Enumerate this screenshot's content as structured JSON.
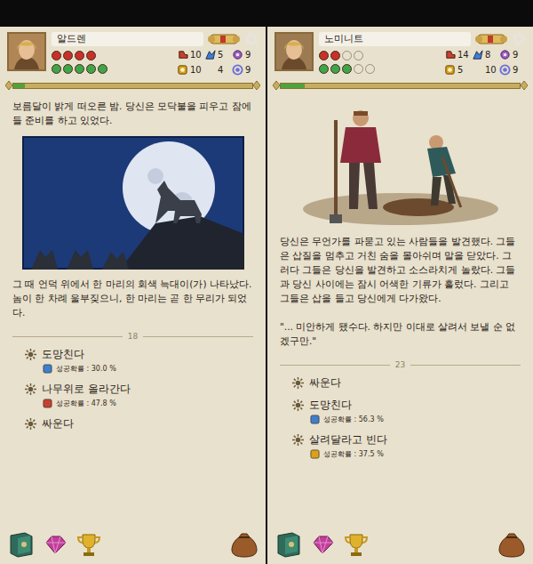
{
  "panels": [
    {
      "character": {
        "name": "알드렌",
        "health": {
          "max": 4,
          "filled": 4
        },
        "stamina": {
          "max": 5,
          "filled": 5
        }
      },
      "stats": [
        {
          "value": "10",
          "color": "#c8412f"
        },
        {
          "value": "5",
          "color": "#3f7fd0"
        },
        {
          "value": "9",
          "color": "#9a5cc0"
        },
        {
          "value": "10",
          "color": "#d9a21c"
        },
        {
          "value": "4",
          "color": "#3f9a45"
        },
        {
          "value": "9",
          "color": "#6a6fd8"
        }
      ],
      "progress": {
        "level": 0.05
      },
      "story": [
        {
          "kind": "text",
          "text": "보름달이 밝게 떠오른 밤. 당신은 모닥불을 피우고 잠에 들 준비를 하고 있었다."
        },
        {
          "kind": "image"
        },
        {
          "kind": "text",
          "text": "그 때 언덕 위에서 한 마리의 회색 늑대이(가) 나타났다. 놈이 한 차례 울부짖으니, 한 마리는 곧 한 무리가 되었다."
        }
      ],
      "page": "18",
      "choices": [
        {
          "label": "도망친다",
          "chance": "성공확률 : 30.0 %",
          "color": "#3f7fd0"
        },
        {
          "label": "나무위로 올라간다",
          "chance": "성공확률 : 47.8 %",
          "color": "#c8412f"
        },
        {
          "label": "싸운다"
        }
      ]
    },
    {
      "character": {
        "name": "노미니트",
        "health": {
          "max": 4,
          "filled": 2
        },
        "stamina": {
          "max": 5,
          "filled": 3
        }
      },
      "stats": [
        {
          "value": "14",
          "color": "#c8412f"
        },
        {
          "value": "8",
          "color": "#3f7fd0"
        },
        {
          "value": "9",
          "color": "#9a5cc0"
        },
        {
          "value": "5",
          "color": "#d9a21c"
        },
        {
          "value": "10",
          "color": "#3f9a45"
        },
        {
          "value": "9",
          "color": "#6a6fd8"
        }
      ],
      "progress": {
        "level": 0.1
      },
      "story": [
        {
          "kind": "image"
        },
        {
          "kind": "text",
          "text": "당신은 무언가를 파묻고 있는 사람들을 발견했다. 그들은 삽질을 멈추고 거친 숨을 몰아쉬며 말을 닫았다. 그러다 그들은 당신을 발견하고 소스라치게 놀랐다. 그들과 당신 사이에는 잠시 어색한 기류가 흘렀다. 그리고 그들은 삽을 들고 당신에게 다가왔다."
        },
        {
          "kind": "quote",
          "text": "\"... 미안하게 됐수다. 하지만 이대로 살려서 보낼 순 없겠구만.\""
        }
      ],
      "page": "23",
      "choices": [
        {
          "label": "싸운다"
        },
        {
          "label": "도망친다",
          "chance": "성공확률 : 56.3 %",
          "color": "#3f7fd0"
        },
        {
          "label": "살려달라고 빈다",
          "chance": "성공확률 : 37.5 %",
          "color": "#d9a21c"
        }
      ]
    }
  ]
}
